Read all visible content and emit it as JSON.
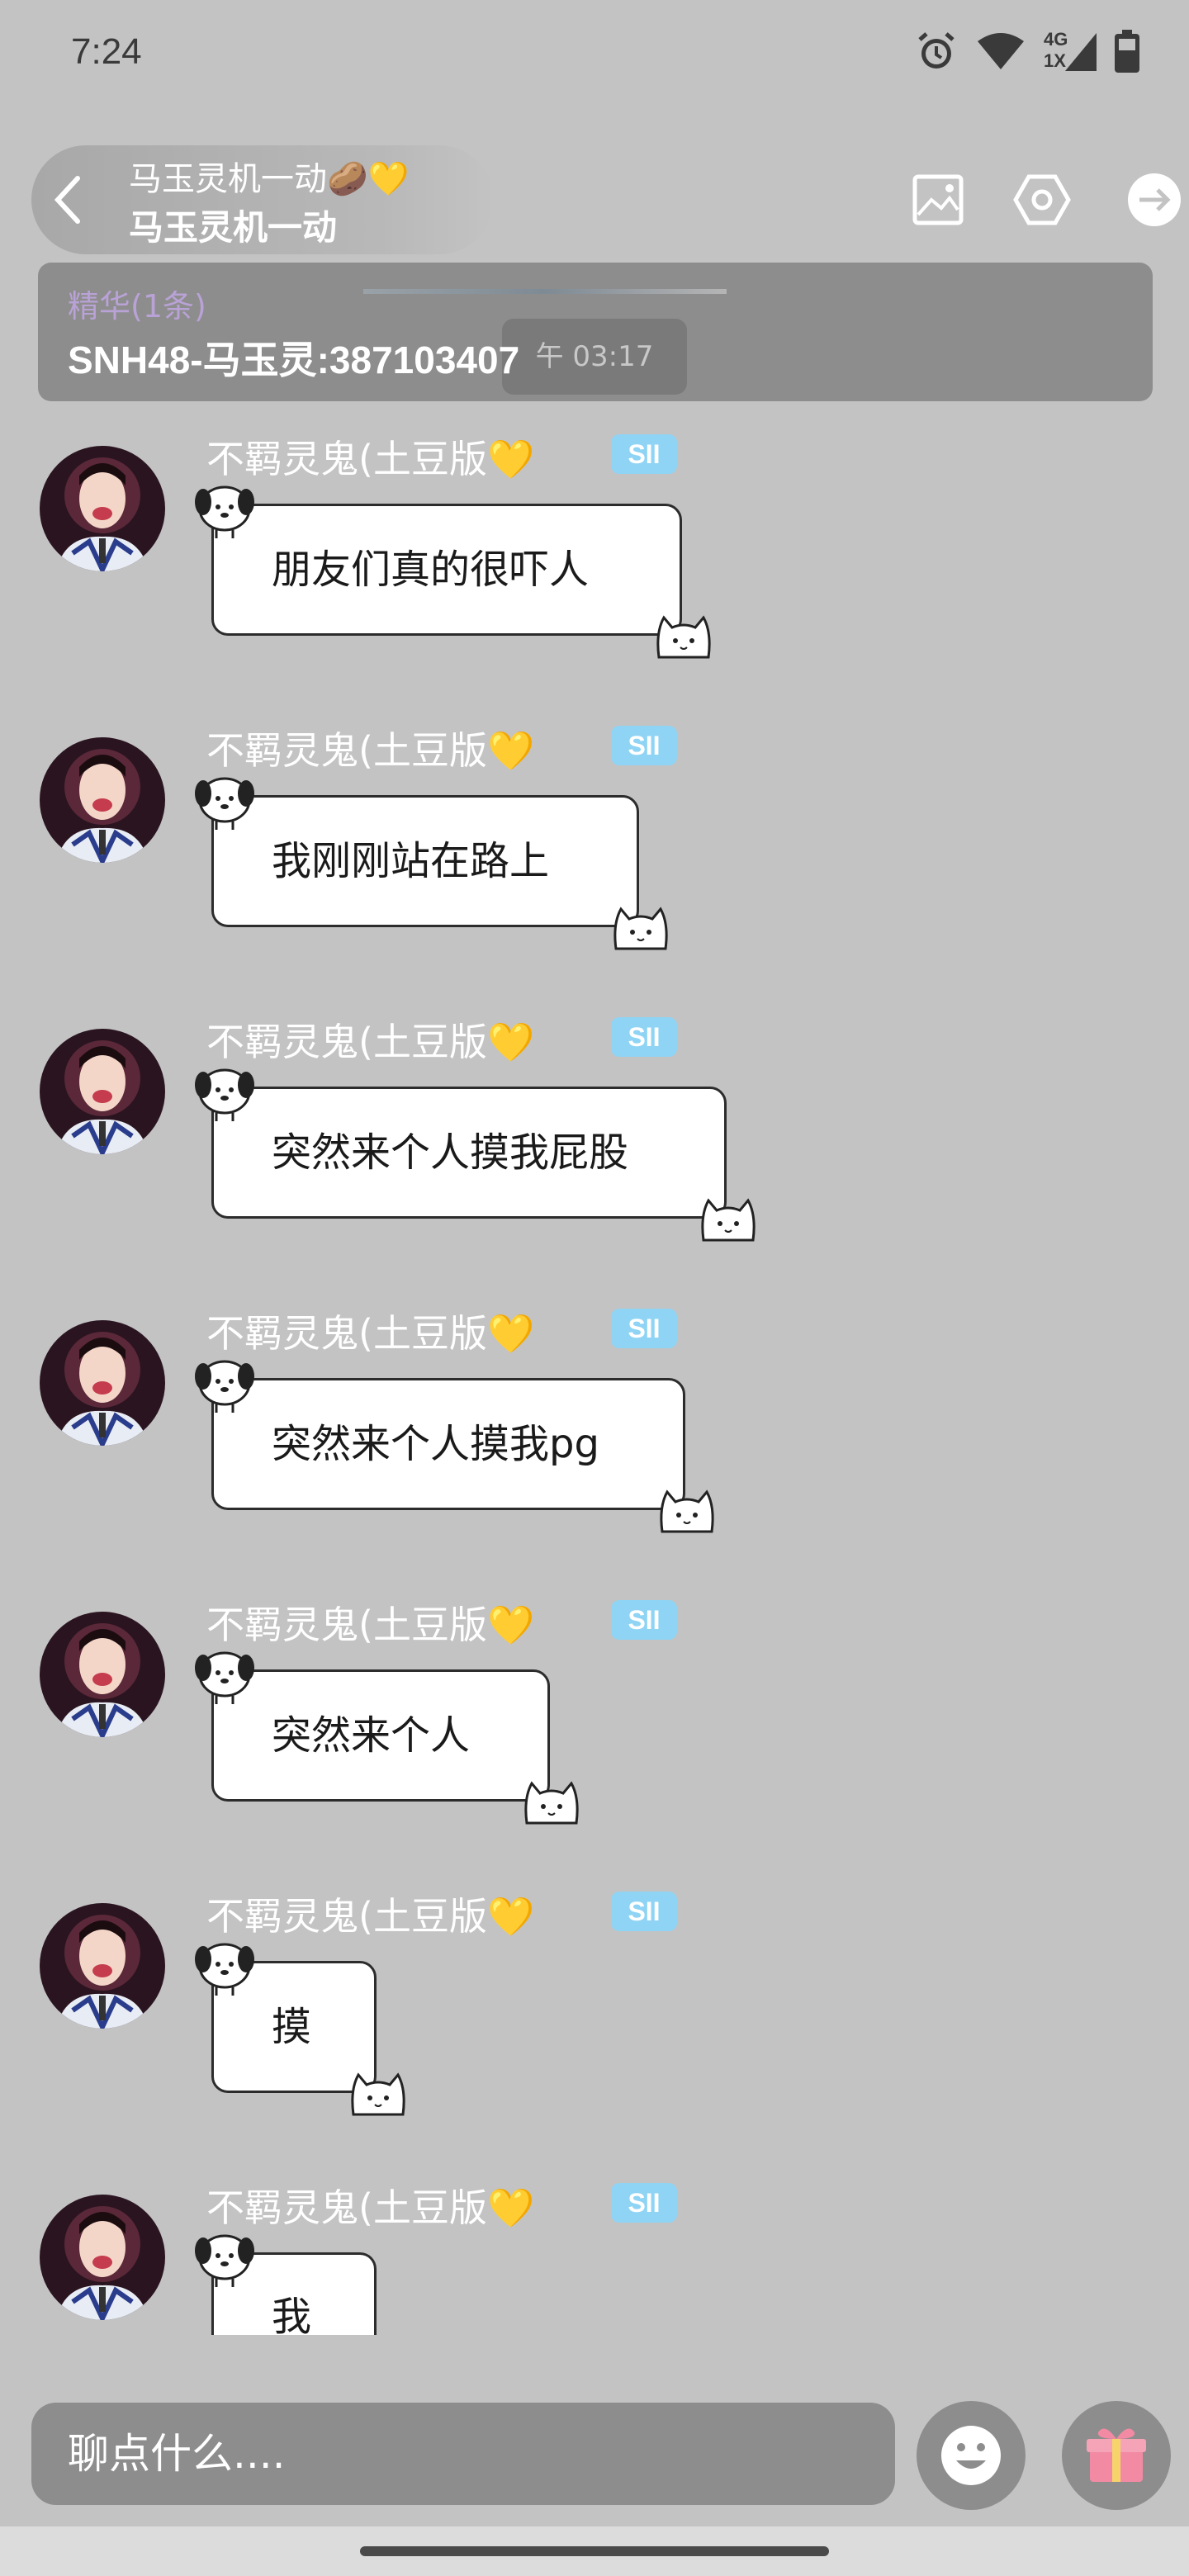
{
  "status_bar": {
    "time": "7:24",
    "icons": [
      "alarm-icon",
      "wifi-icon",
      "signal-icon",
      "battery-icon"
    ],
    "network_top": "4G",
    "network_bottom": "1X"
  },
  "header": {
    "title": "马玉灵机一动🥔💛",
    "subtitle": "马玉灵机一动"
  },
  "pinned": {
    "label": "精华(1条)",
    "text": "SNH48-马玉灵:387103407",
    "time": "午 03:17"
  },
  "messages": [
    {
      "sender": "不羁灵鬼(土豆版",
      "heart": "💛",
      "badge": "SII",
      "text": "朋友们真的很吓人"
    },
    {
      "sender": "不羁灵鬼(土豆版",
      "heart": "💛",
      "badge": "SII",
      "text": "我刚刚站在路上"
    },
    {
      "sender": "不羁灵鬼(土豆版",
      "heart": "💛",
      "badge": "SII",
      "text": "突然来个人摸我屁股"
    },
    {
      "sender": "不羁灵鬼(土豆版",
      "heart": "💛",
      "badge": "SII",
      "text": "突然来个人摸我pg"
    },
    {
      "sender": "不羁灵鬼(土豆版",
      "heart": "💛",
      "badge": "SII",
      "text": "突然来个人"
    },
    {
      "sender": "不羁灵鬼(土豆版",
      "heart": "💛",
      "badge": "SII",
      "text": "摸"
    },
    {
      "sender": "不羁灵鬼(土豆版",
      "heart": "💛",
      "badge": "SII",
      "text": "我"
    }
  ],
  "input": {
    "placeholder": "聊点什么...."
  },
  "colors": {
    "background": "#c3c3c3",
    "badge": "#8fd4f4",
    "essence_label": "#b9a2d6"
  }
}
